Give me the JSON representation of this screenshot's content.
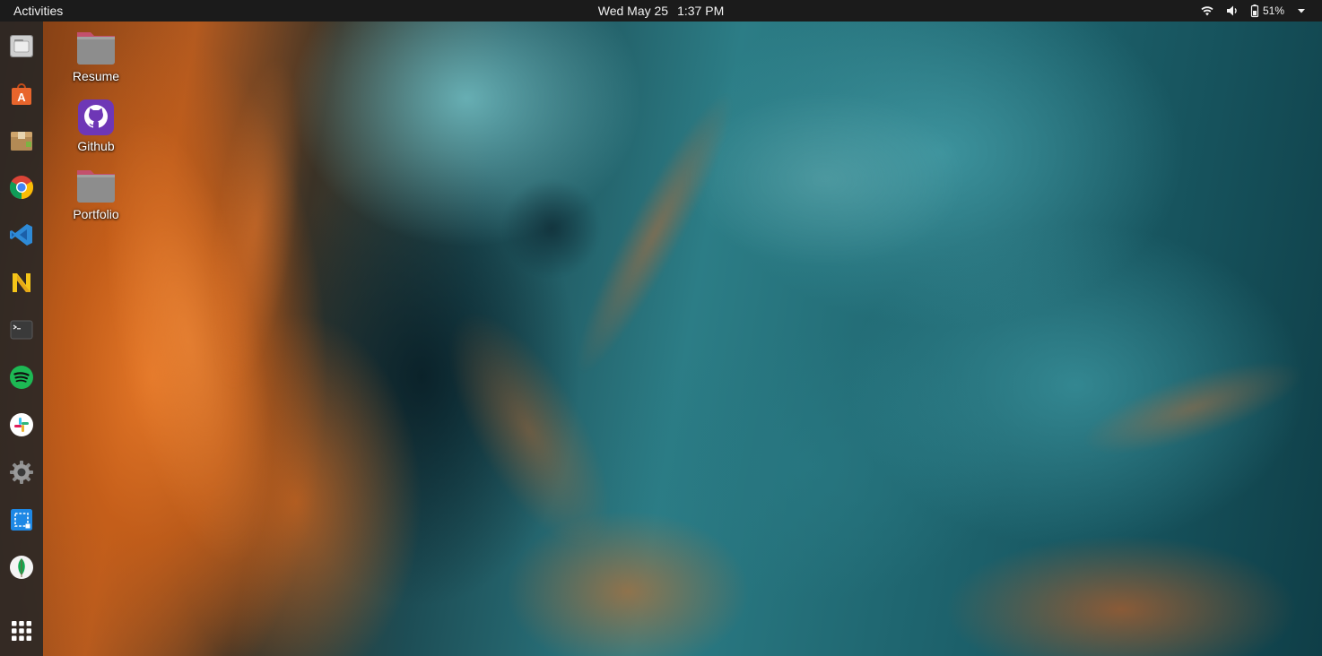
{
  "topbar": {
    "activities_label": "Activities",
    "date": "Wed May 25",
    "time": "1:37 PM",
    "battery_percent": "51%",
    "tray_icons": [
      "wifi-icon",
      "volume-icon",
      "battery-icon",
      "system-menu-caret-icon"
    ]
  },
  "dock": {
    "apps": [
      {
        "name": "files",
        "icon": "folder-icon"
      },
      {
        "name": "ubuntu-software",
        "icon": "shopping-bag-icon"
      },
      {
        "name": "archive-manager",
        "icon": "package-icon"
      },
      {
        "name": "google-chrome",
        "icon": "chrome-icon"
      },
      {
        "name": "visual-studio-code",
        "icon": "vscode-icon"
      },
      {
        "name": "joplin",
        "icon": "n-letter-icon"
      },
      {
        "name": "terminal",
        "icon": "terminal-icon"
      },
      {
        "name": "spotify",
        "icon": "spotify-icon"
      },
      {
        "name": "slack",
        "icon": "slack-icon"
      },
      {
        "name": "settings",
        "icon": "gear-icon"
      },
      {
        "name": "screenshot",
        "icon": "screenshot-icon"
      },
      {
        "name": "mongodb-compass",
        "icon": "leaf-icon"
      },
      {
        "name": "show-applications",
        "icon": "app-grid-icon"
      }
    ]
  },
  "desktop": {
    "icons": [
      {
        "label": "Resume",
        "icon": "folder-icon"
      },
      {
        "label": "Github",
        "icon": "github-icon"
      },
      {
        "label": "Portfolio",
        "icon": "folder-icon"
      }
    ]
  },
  "colors": {
    "topbar_bg": "#1b1b1b",
    "dock_bg": "#262626",
    "folder_pink": "#c3506d",
    "folder_gray": "#8d8d8d",
    "github_purple": "#6e37b6"
  }
}
